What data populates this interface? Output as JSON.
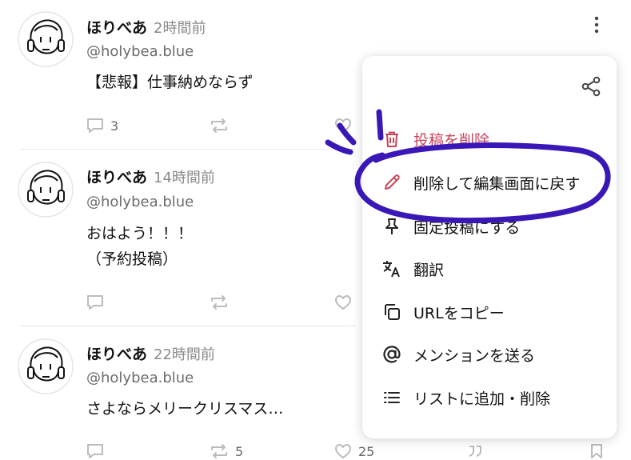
{
  "posts": [
    {
      "name": "ほりべあ",
      "time": "2時間前",
      "handle": "@holybea.blue",
      "text_lines": [
        "【悲報】仕事納めならず"
      ],
      "reply_count": "3",
      "repost_count": "",
      "like_count": ""
    },
    {
      "name": "ほりべあ",
      "time": "14時間前",
      "handle": "@holybea.blue",
      "text_lines": [
        "おはよう！！！",
        "（予約投稿）"
      ],
      "reply_count": "",
      "repost_count": "",
      "like_count": ""
    },
    {
      "name": "ほりべあ",
      "time": "22時間前",
      "handle": "@holybea.blue",
      "text_lines": [
        "さよならメリークリスマス…"
      ],
      "reply_count": "",
      "repost_count": "5",
      "like_count": "25"
    }
  ],
  "menu": {
    "items": [
      {
        "label": "投稿を削除",
        "icon": "trash-icon",
        "danger": true
      },
      {
        "label": "削除して編集画面に戻す",
        "icon": "pencil-icon",
        "danger": false
      },
      {
        "label": "固定投稿にする",
        "icon": "pin-icon",
        "danger": false
      },
      {
        "label": "翻訳",
        "icon": "translate-icon",
        "danger": false
      },
      {
        "label": "URLをコピー",
        "icon": "copy-icon",
        "danger": false
      },
      {
        "label": "メンションを送る",
        "icon": "at-sign-icon",
        "danger": false
      },
      {
        "label": "リストに追加・削除",
        "icon": "list-icon",
        "danger": false
      }
    ],
    "share_icon": "share-icon"
  },
  "colors": {
    "danger": "#c8455a",
    "annotation": "#3a18b8",
    "muted_icon": "#b9bcc0",
    "secondary_text": "#6b6b6b"
  }
}
